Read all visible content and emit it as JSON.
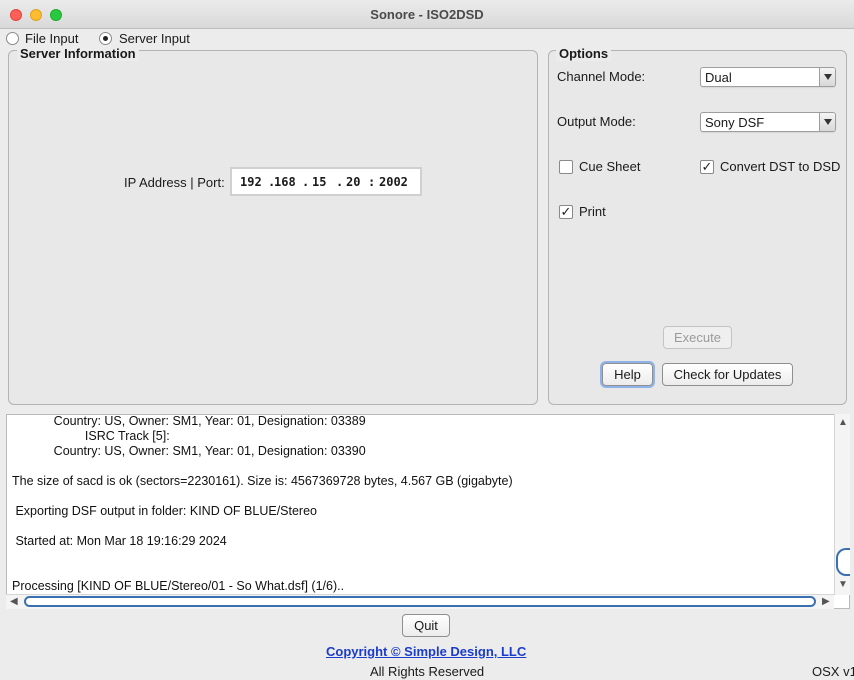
{
  "window": {
    "title": "Sonore - ISO2DSD"
  },
  "input_mode": {
    "file_input_label": "File Input",
    "server_input_label": "Server Input",
    "selected": "Server Input"
  },
  "server_info": {
    "legend": "Server Information",
    "ip_label": "IP Address | Port:",
    "ip1": "192",
    "ip2": "168",
    "ip3": "15",
    "ip4": "20",
    "port": "2002"
  },
  "options": {
    "legend": "Options",
    "channel_mode_label": "Channel Mode:",
    "channel_mode_value": "Dual",
    "output_mode_label": "Output Mode:",
    "output_mode_value": "Sony DSF",
    "cue_sheet_label": "Cue Sheet",
    "cue_sheet_checked": false,
    "convert_dst_label": "Convert DST to DSD",
    "convert_dst_checked": true,
    "print_label": "Print",
    "print_checked": true,
    "execute_label": "Execute",
    "help_label": "Help",
    "check_updates_label": "Check for Updates"
  },
  "log": {
    "lines": [
      "            Country: US, Owner: SM1, Year: 01, Designation: 03389",
      "                     ISRC Track [5]:",
      "            Country: US, Owner: SM1, Year: 01, Designation: 03390",
      "",
      "The size of sacd is ok (sectors=2230161). Size is: 4567369728 bytes, 4.567 GB (gigabyte)",
      "",
      " Exporting DSF output in folder: KIND OF BLUE/Stereo",
      "",
      " Started at: Mon Mar 18 19:16:29 2024",
      "",
      "",
      "Processing [KIND OF BLUE/Stereo/01 - So What.dsf] (1/6).."
    ]
  },
  "footer": {
    "quit_label": "Quit",
    "copyright": "Copyright © Simple Design, LLC",
    "rights": "All Rights Reserved",
    "os_version": "OSX v1"
  }
}
